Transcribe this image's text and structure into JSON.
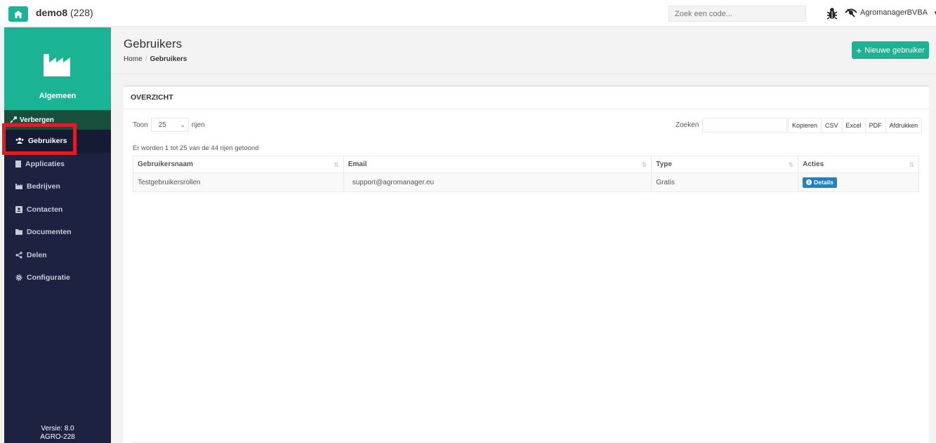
{
  "topbar": {
    "title": "demo8",
    "count": "(228)",
    "search_placeholder": "Zoek een code...",
    "user_name": "AgromanagerBVBA",
    "home_icon": "home-icon",
    "bug_icon": "bug-icon"
  },
  "sidebar": {
    "section": "Algemeen",
    "hide_label": "Verbergen",
    "items": [
      {
        "label": "Gebruikers",
        "icon": "users-icon"
      },
      {
        "label": "Applicaties",
        "icon": "file-icon"
      },
      {
        "label": "Bedrijven",
        "icon": "industry-icon"
      },
      {
        "label": "Contacten",
        "icon": "address-card-icon"
      },
      {
        "label": "Documenten",
        "icon": "folder-icon"
      },
      {
        "label": "Delen",
        "icon": "share-icon"
      },
      {
        "label": "Configuratie",
        "icon": "cog-icon"
      }
    ],
    "version_line1": "Versie: 8.0",
    "version_line2": "AGRO-228"
  },
  "heading": {
    "title": "Gebruikers",
    "breadcrumb_home": "Home",
    "breadcrumb_current": "Gebruikers",
    "new_user_label": "Nieuwe gebruiker"
  },
  "panel": {
    "title": "OVERZICHT",
    "show_label": "Toon",
    "page_length": "25",
    "rows_label": "rijen",
    "search_label": "Zoeken",
    "export_buttons": [
      "Kopieren",
      "CSV",
      "Excel",
      "PDF",
      "Afdrukken"
    ],
    "info": "Er worden 1 tot 25 van de 44 rijen getoond",
    "columns": [
      "Gebruikersnaam",
      "Email",
      "Type",
      "Acties"
    ],
    "rows": [
      {
        "username": "Testgebruikersrollen",
        "email": "support@agromanager.eu",
        "type": "Gratis",
        "action": "Details"
      }
    ]
  },
  "colors": {
    "accent": "#1ab394",
    "sidebar_bg": "#1c2240",
    "details_btn": "#1c84c6",
    "highlight": "#e21c24"
  }
}
